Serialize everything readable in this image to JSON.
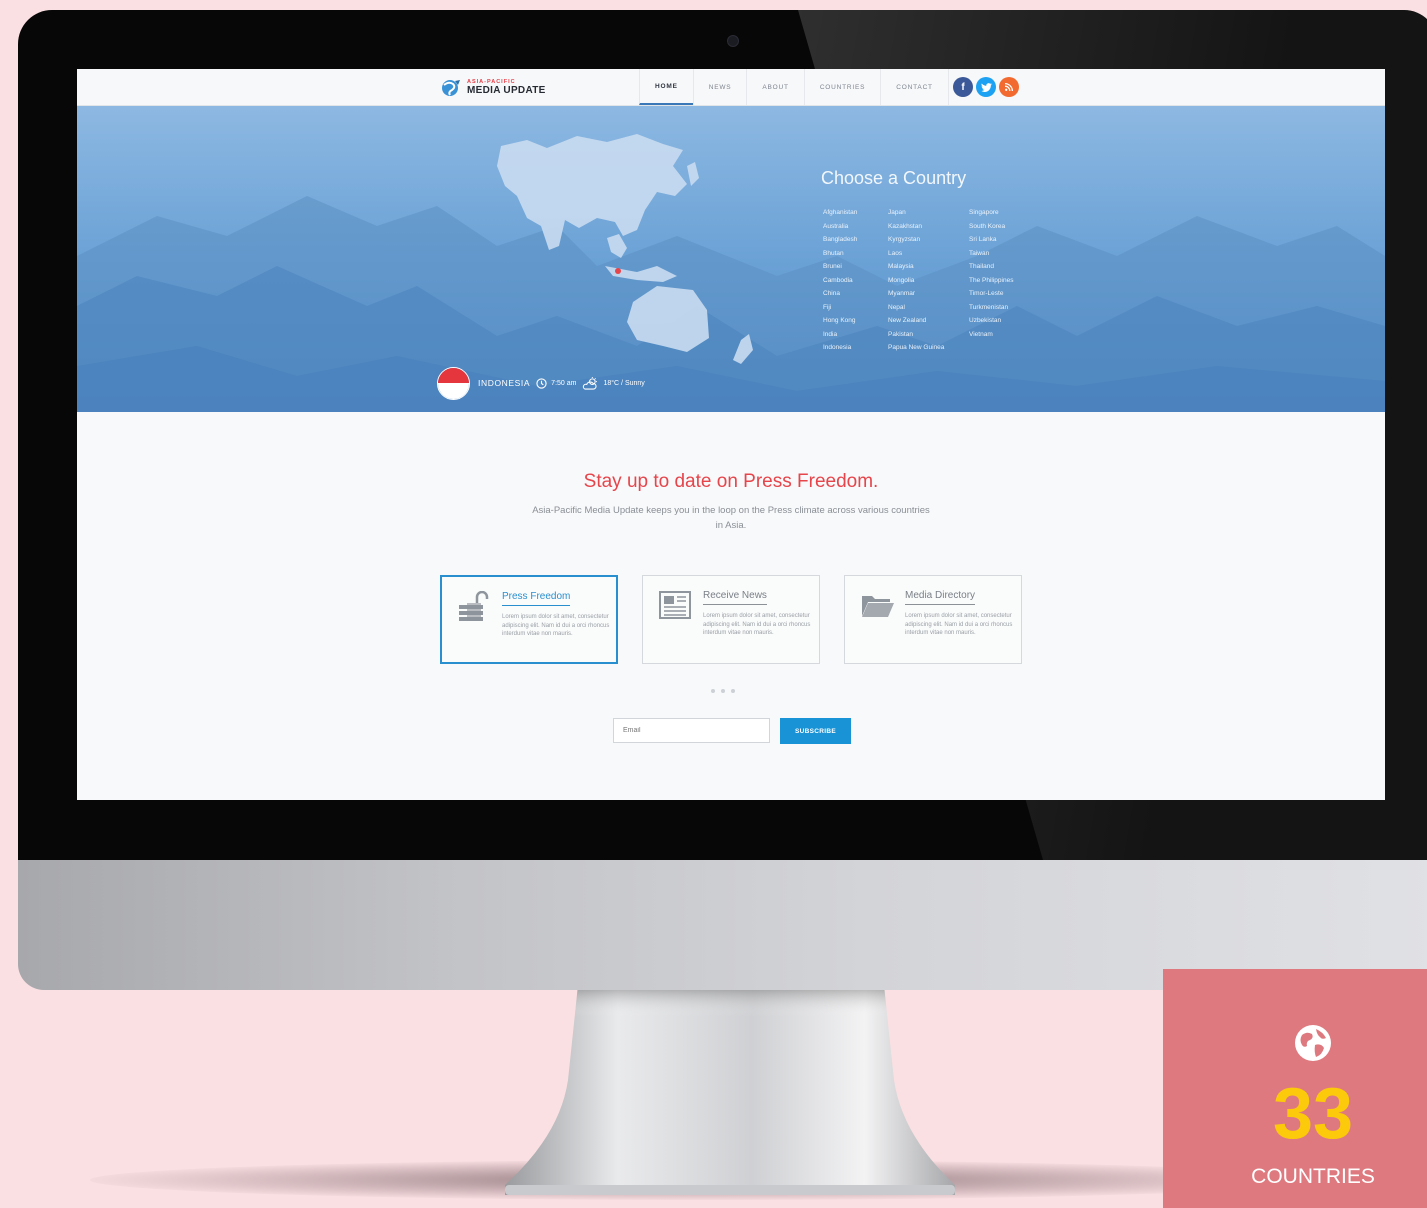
{
  "site": {
    "logo_small": "ASIA-PACIFIC",
    "logo_big": "MEDIA UPDATE",
    "nav": [
      "HOME",
      "NEWS",
      "ABOUT",
      "COUNTRIES",
      "CONTACT"
    ],
    "active_nav": "HOME",
    "social": [
      {
        "icon": "facebook-icon",
        "glyph": "f",
        "color": "#3b5998"
      },
      {
        "icon": "twitter-icon",
        "glyph": "t",
        "color": "#1da1f2"
      },
      {
        "icon": "rss-icon",
        "glyph": "r",
        "color": "#f26a30"
      }
    ]
  },
  "hero": {
    "title": "Choose a Country",
    "countries": [
      [
        "Afghanistan",
        "Australia",
        "Bangladesh",
        "Bhutan",
        "Brunei",
        "Cambodia",
        "China",
        "Fiji",
        "Hong Kong",
        "India",
        "Indonesia"
      ],
      [
        "Japan",
        "Kazakhstan",
        "Kyrgyzstan",
        "Laos",
        "Malaysia",
        "Mongolia",
        "Myanmar",
        "Nepal",
        "New Zealand",
        "Pakistan",
        "Papua New Guinea"
      ],
      [
        "Singapore",
        "South Korea",
        "Sri Lanka",
        "Taiwan",
        "Thailand",
        "The Philippines",
        "Timor-Leste",
        "Turkmenistan",
        "Uzbekistan",
        "Vietnam"
      ]
    ],
    "status": {
      "country": "INDONESIA",
      "time": "7:50 am",
      "weather": "18°C / Sunny",
      "flag_colors": [
        "#e5363e",
        "#ffffff"
      ]
    }
  },
  "intro": {
    "heading": "Stay up to date on Press Freedom.",
    "subtext": "Asia-Pacific Media Update keeps you in the loop on the Press climate across various countries in Asia."
  },
  "features": [
    {
      "title": "Press Freedom",
      "icon": "unlocked-padlock-icon",
      "text": "Lorem ipsum dolor sit amet, consectetur adipiscing elit. Nam id dui a orci rhoncus interdum vitae non mauris.",
      "active": true
    },
    {
      "title": "Receive News",
      "icon": "newspaper-icon",
      "text": "Lorem ipsum dolor sit amet, consectetur adipiscing elit. Nam id dui a orci rhoncus interdum vitae non mauris.",
      "active": false
    },
    {
      "title": "Media Directory",
      "icon": "folder-icon",
      "text": "Lorem ipsum dolor sit amet, consectetur adipiscing elit. Nam id dui a orci rhoncus interdum vitae non mauris.",
      "active": false
    }
  ],
  "subscribe": {
    "placeholder": "Email",
    "button": "SUBSCRIBE"
  },
  "badge": {
    "icon": "globe-icon",
    "number": "33",
    "label": "COUNTRIES"
  },
  "colors": {
    "accent_red": "#e5454b",
    "accent_blue": "#1a93d6",
    "badge_bg": "#de7a7f",
    "badge_number": "#fcca0a",
    "page_bg": "#fbe0e3"
  }
}
